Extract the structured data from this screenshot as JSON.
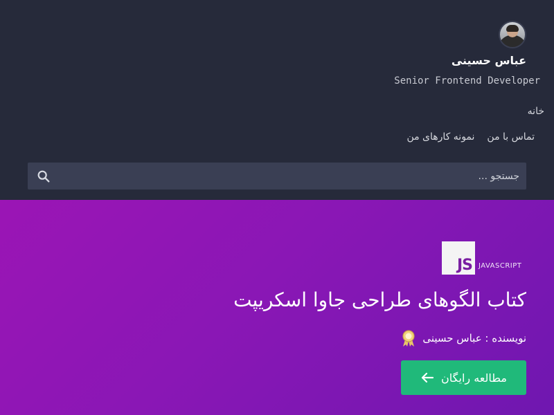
{
  "profile": {
    "name": "عباس حسینی",
    "role": "Senior Frontend Developer"
  },
  "nav": {
    "home": "خانه",
    "portfolio": "نمونه کارهای من",
    "contact": "تماس با من"
  },
  "search": {
    "placeholder": "جستجو ..."
  },
  "hero": {
    "logo_text": "JS",
    "category": "JAVASCRIPT",
    "title": "کتاب الگوهای طراحی جاوا اسکریپت",
    "author": "نویسنده : عباس حسینی",
    "cta_label": "مطالعه رایگان"
  },
  "colors": {
    "header_bg": "#262a3a",
    "search_bg": "#3a3f54",
    "hero_gradient_start": "#9b15b5",
    "hero_gradient_end": "#6f17b0",
    "cta_bg": "#20b97a",
    "logo_text": "#7a1fa2"
  },
  "icons": {
    "search": "search-icon",
    "author_badge": "award-badge-icon",
    "cta_arrow": "arrow-left-icon"
  }
}
